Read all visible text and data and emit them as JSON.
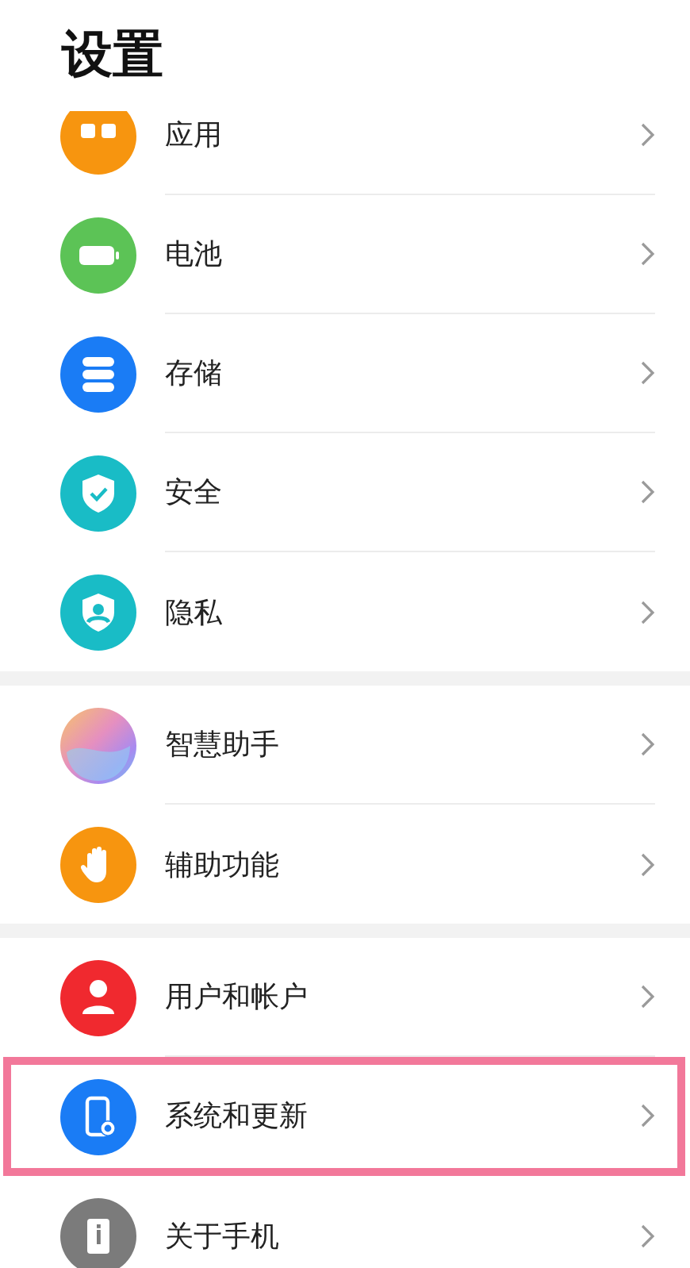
{
  "title": "设置",
  "groups": [
    {
      "items": [
        {
          "label": "应用",
          "kind": "apps",
          "highlighted": false
        },
        {
          "label": "电池",
          "kind": "battery",
          "highlighted": false
        },
        {
          "label": "存储",
          "kind": "storage",
          "highlighted": false
        },
        {
          "label": "安全",
          "kind": "security",
          "highlighted": false
        },
        {
          "label": "隐私",
          "kind": "privacy",
          "highlighted": false
        }
      ]
    },
    {
      "items": [
        {
          "label": "智慧助手",
          "kind": "assistant",
          "highlighted": false
        },
        {
          "label": "辅助功能",
          "kind": "accessibility",
          "highlighted": false
        }
      ]
    },
    {
      "items": [
        {
          "label": "用户和帐户",
          "kind": "user",
          "highlighted": false
        },
        {
          "label": "系统和更新",
          "kind": "system",
          "highlighted": true
        },
        {
          "label": "关于手机",
          "kind": "about",
          "highlighted": false
        }
      ]
    }
  ]
}
